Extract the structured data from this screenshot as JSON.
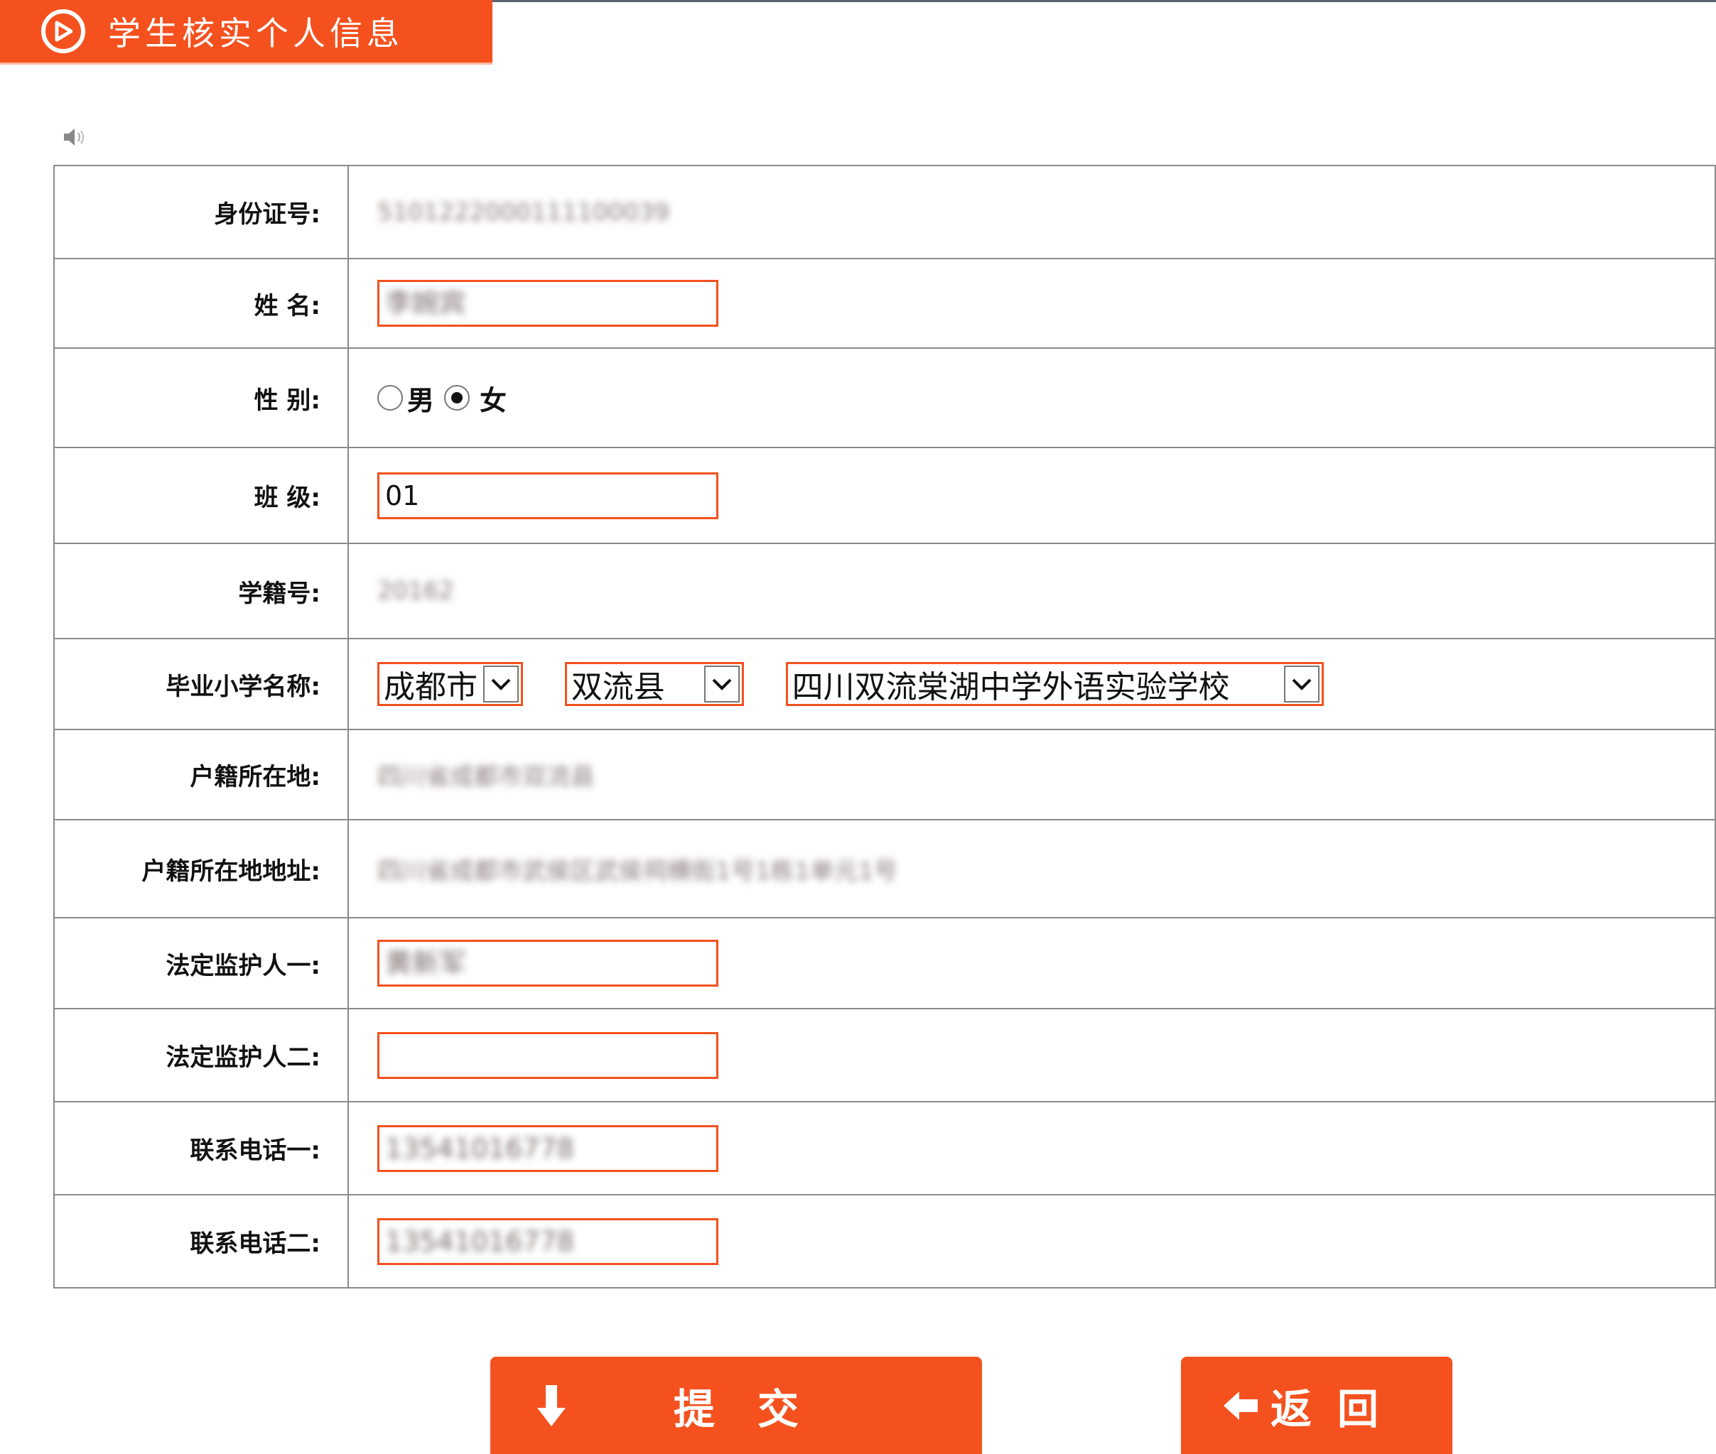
{
  "header": {
    "title": "学生核实个人信息"
  },
  "form": {
    "id_card": {
      "label": "身份证号:",
      "value": "5101222000111100039"
    },
    "name": {
      "label": "姓  名:",
      "value": "李婉宾"
    },
    "gender": {
      "label": "性  别:",
      "options": [
        "男",
        "女"
      ],
      "selected": "女"
    },
    "class": {
      "label": "班  级:",
      "value": "01"
    },
    "student_no": {
      "label": "学籍号:",
      "value": "20162"
    },
    "primary_school": {
      "label": "毕业小学名称:",
      "city": "成都市",
      "county": "双流县",
      "school": "四川双流棠湖中学外语实验学校"
    },
    "household_location": {
      "label": "户籍所在地:",
      "value": "四川省成都市双流县"
    },
    "household_address": {
      "label": "户籍所在地地址:",
      "value": "四川省成都市武侯区武侯祠横街1号1栋1单元1号"
    },
    "guardian1": {
      "label": "法定监护人一:",
      "value": "黄新军"
    },
    "guardian2": {
      "label": "法定监护人二:",
      "value": ""
    },
    "phone1": {
      "label": "联系电话一:",
      "value": "13541016778"
    },
    "phone2": {
      "label": "联系电话二:",
      "value": "13541016778"
    }
  },
  "buttons": {
    "submit": "提交",
    "back": "返回"
  },
  "colors": {
    "accent": "#f4511e",
    "border": "#8a8a8a",
    "topline": "#5a6470"
  },
  "icons": {
    "header": "play-circle-icon",
    "speaker": "speaker-icon",
    "submit": "arrow-down-icon",
    "back": "arrow-left-icon",
    "select": "chevron-down-icon"
  }
}
